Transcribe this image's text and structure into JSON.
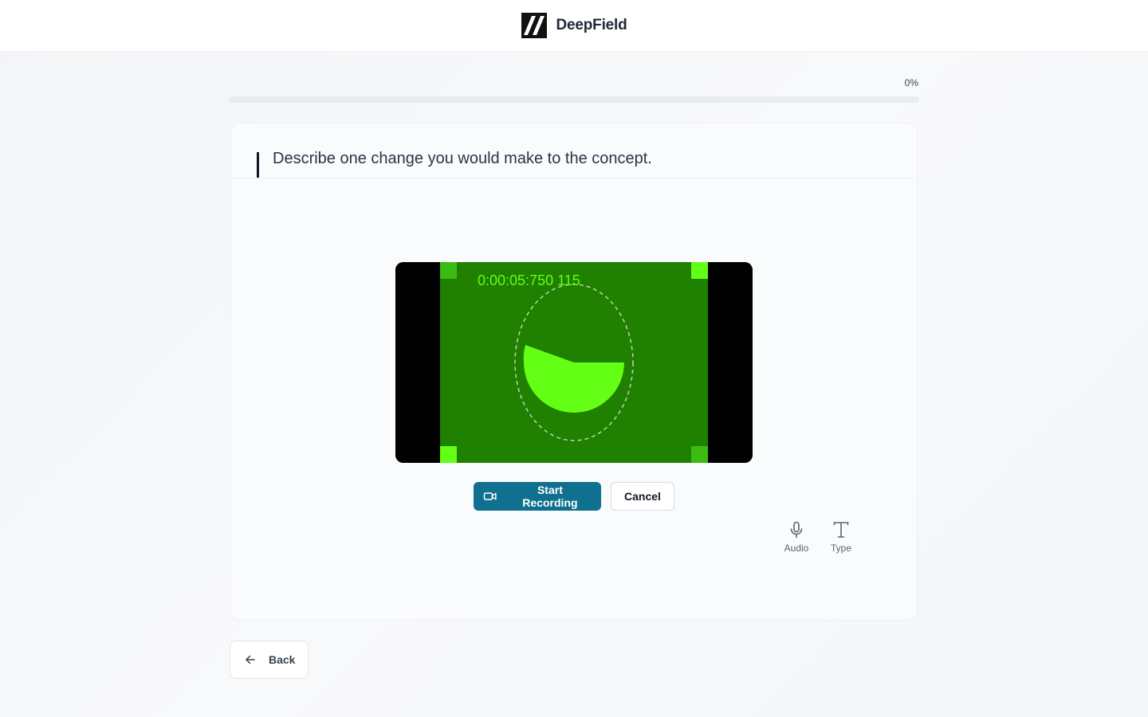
{
  "header": {
    "brand_name": "DeepField",
    "logo_icon": "deepfield-logo-icon"
  },
  "progress": {
    "label": "0%",
    "value": 0
  },
  "question": {
    "text": "Describe one change you would make to the concept."
  },
  "video_preview": {
    "timecode": "0:00:05:750 115",
    "colors": {
      "background": "#000000",
      "frame": "#208000",
      "bright": "#63ff14",
      "marker_dark": "#3cbb12"
    }
  },
  "controls": {
    "start_label": "Start Recording",
    "start_icon": "video-camera-icon",
    "cancel_label": "Cancel",
    "accent": "#10708f"
  },
  "response_modes": [
    {
      "label": "Audio",
      "icon": "microphone-icon"
    },
    {
      "label": "Type",
      "icon": "text-type-icon"
    }
  ],
  "navigation": {
    "back_label": "Back",
    "back_icon": "arrow-left-icon"
  }
}
